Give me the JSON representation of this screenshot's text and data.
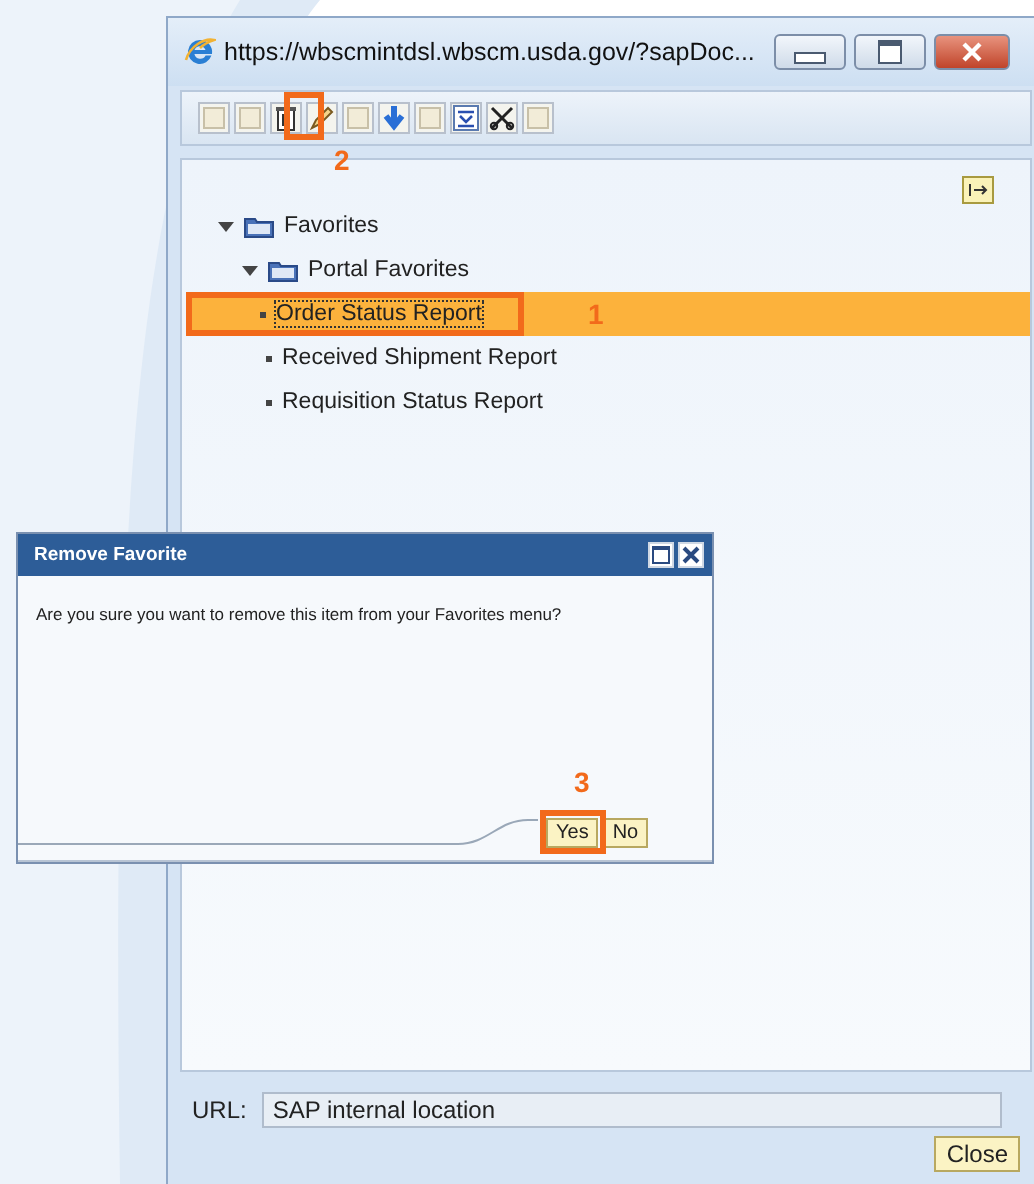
{
  "window": {
    "title": "https://wbscmintdsl.wbscm.usda.gov/?sapDoc..."
  },
  "tree": [
    {
      "label": "Favorites",
      "expanded": true,
      "children": [
        {
          "label": "Portal Favorites",
          "expanded": true,
          "children": [
            {
              "label": "Order Status Report",
              "selected": true
            },
            {
              "label": "Received Shipment Report",
              "selected": false
            },
            {
              "label": "Requisition Status Report",
              "selected": false
            }
          ]
        }
      ]
    }
  ],
  "url": {
    "label": "URL:",
    "value": "SAP internal location"
  },
  "close_button": "Close",
  "dialog": {
    "title": "Remove Favorite",
    "message": "Are you sure you want to remove this item from your Favorites menu?",
    "buttons": [
      "Yes",
      "No"
    ]
  },
  "callouts": [
    "1",
    "2",
    "3"
  ]
}
